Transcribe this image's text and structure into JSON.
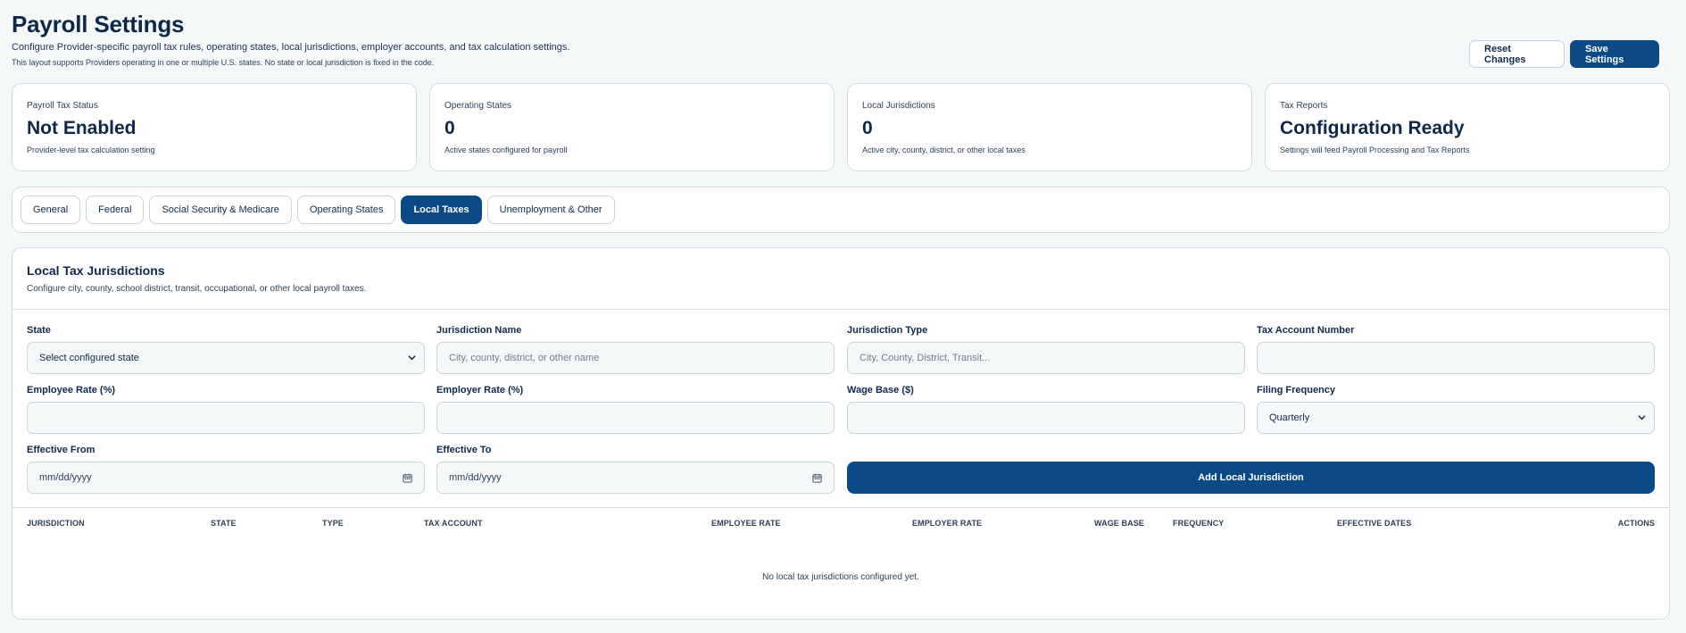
{
  "header": {
    "title": "Payroll Settings",
    "subtitle": "Configure Provider-specific payroll tax rules, operating states, local jurisdictions, employer accounts, and tax calculation settings.",
    "note": "This layout supports Providers operating in one or multiple U.S. states. No state or local jurisdiction is fixed in the code.",
    "reset_label": "Reset Changes",
    "save_label": "Save Settings"
  },
  "stats": [
    {
      "label": "Payroll Tax Status",
      "value": "Not Enabled",
      "desc": "Provider-level tax calculation setting"
    },
    {
      "label": "Operating States",
      "value": "0",
      "desc": "Active states configured for payroll"
    },
    {
      "label": "Local Jurisdictions",
      "value": "0",
      "desc": "Active city, county, district, or other local taxes"
    },
    {
      "label": "Tax Reports",
      "value": "Configuration Ready",
      "desc": "Settings will feed Payroll Processing and Tax Reports"
    }
  ],
  "tabs": [
    {
      "label": "General"
    },
    {
      "label": "Federal"
    },
    {
      "label": "Social Security & Medicare"
    },
    {
      "label": "Operating States"
    },
    {
      "label": "Local Taxes",
      "active": true
    },
    {
      "label": "Unemployment & Other"
    }
  ],
  "panel": {
    "title": "Local Tax Jurisdictions",
    "desc": "Configure city, county, school district, transit, occupational, or other local payroll taxes."
  },
  "form": {
    "state": {
      "label": "State",
      "value": "Select configured state"
    },
    "jurisdiction_name": {
      "label": "Jurisdiction Name",
      "placeholder": "City, county, district, or other name"
    },
    "jurisdiction_type": {
      "label": "Jurisdiction Type",
      "placeholder": "City, County, District, Transit..."
    },
    "tax_account": {
      "label": "Tax Account Number",
      "value": ""
    },
    "employee_rate": {
      "label": "Employee Rate (%)",
      "value": ""
    },
    "employer_rate": {
      "label": "Employer Rate (%)",
      "value": ""
    },
    "wage_base": {
      "label": "Wage Base ($)",
      "value": ""
    },
    "filing_frequency": {
      "label": "Filing Frequency",
      "value": "Quarterly"
    },
    "effective_from": {
      "label": "Effective From",
      "value": "mm/dd/yyyy"
    },
    "effective_to": {
      "label": "Effective To",
      "value": "mm/dd/yyyy"
    },
    "add_label": "Add Local Jurisdiction"
  },
  "table": {
    "columns": [
      "Jurisdiction",
      "State",
      "Type",
      "Tax Account",
      "Employee Rate",
      "Employer Rate",
      "Wage Base",
      "Frequency",
      "Effective Dates",
      "Actions"
    ],
    "empty_message": "No local tax jurisdictions configured yet."
  },
  "colors": {
    "primary": "#0c4a86",
    "background": "#f4f8f9",
    "text": "#0d2848",
    "border": "#cfdde3"
  },
  "icons": {
    "select_caret": "chevron-down-icon",
    "date_picker": "calendar-icon"
  }
}
